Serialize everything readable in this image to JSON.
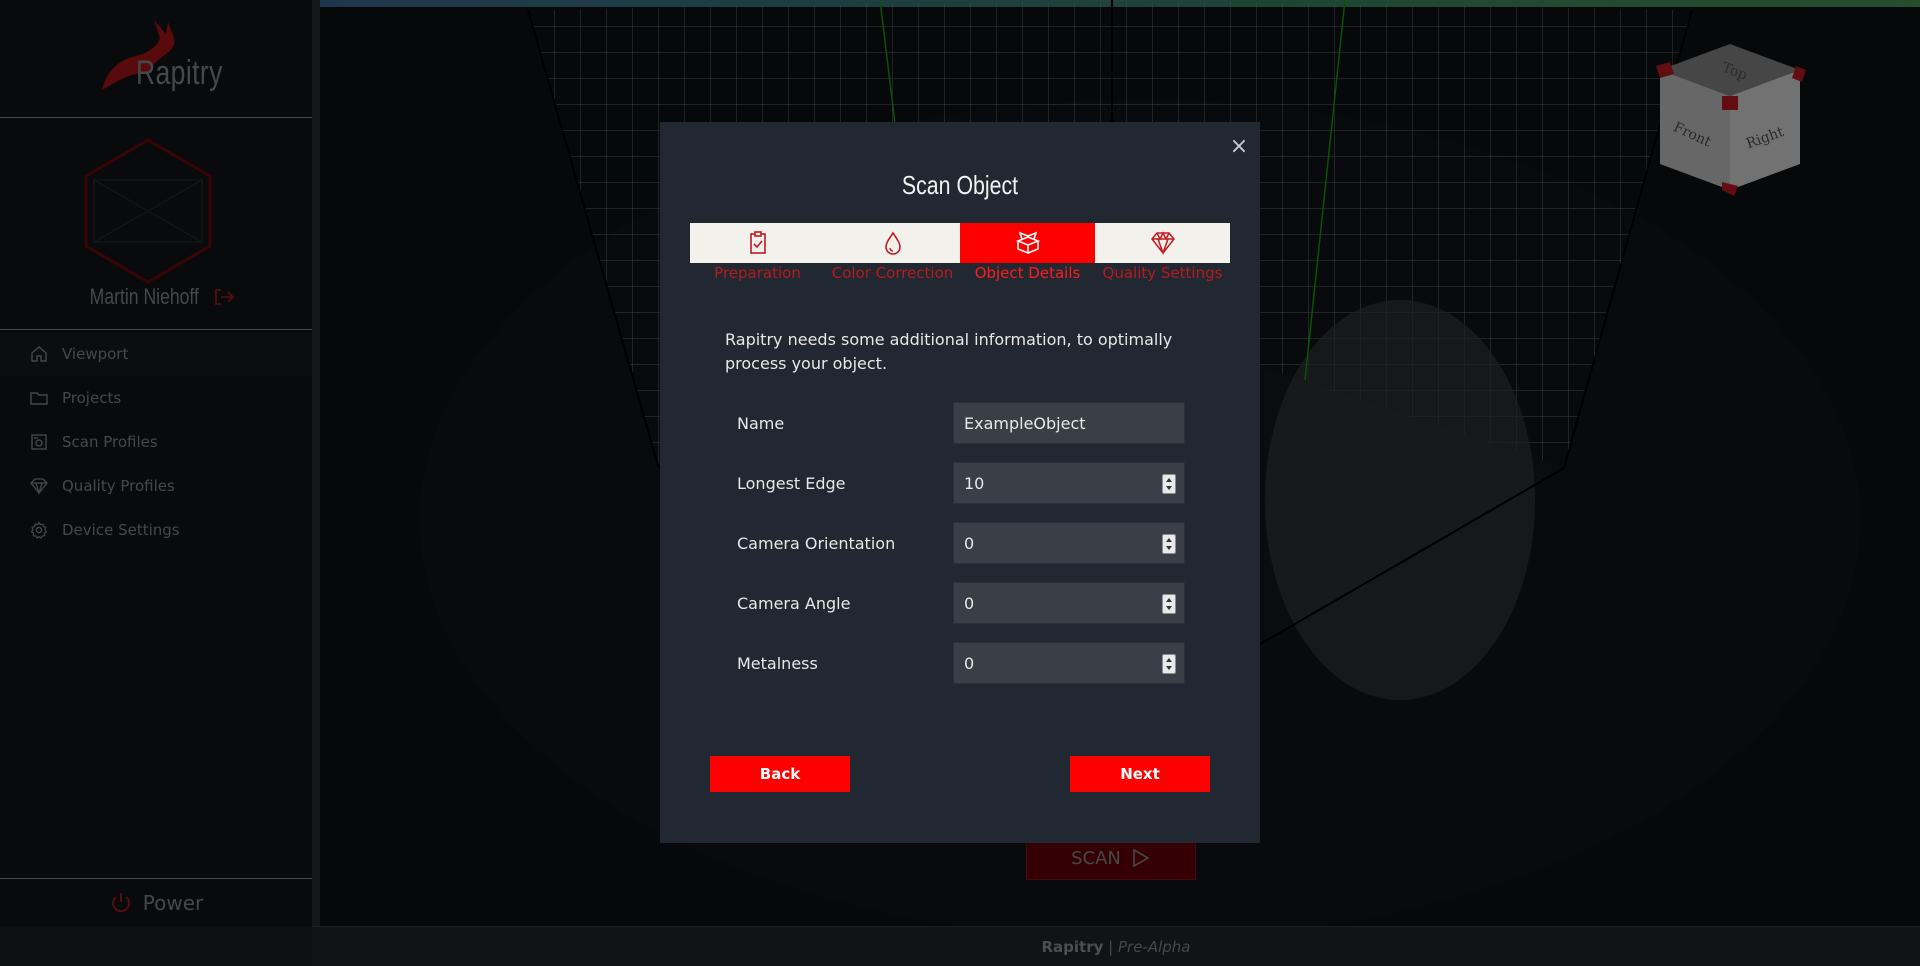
{
  "app": {
    "name": "Rapitry"
  },
  "user": {
    "name": "Martin Niehoff"
  },
  "sidebar": {
    "items": [
      {
        "label": "Viewport",
        "icon": "home-icon",
        "stripe": "#3a6d9a"
      },
      {
        "label": "Projects",
        "icon": "folder-icon",
        "stripe": "#2f8c86"
      },
      {
        "label": "Scan Profiles",
        "icon": "camera-icon",
        "stripe": "#3f9a4e"
      },
      {
        "label": "Quality Profiles",
        "icon": "diamond-icon",
        "stripe": "#8a9a2a"
      },
      {
        "label": "Device Settings",
        "icon": "gear-icon",
        "stripe": "#a02a2a"
      }
    ],
    "power_label": "Power"
  },
  "viewport": {
    "scan_label": "SCAN"
  },
  "footer": {
    "brand": "Rapitry",
    "separator": " | ",
    "stage": "Pre-Alpha"
  },
  "modal": {
    "title": "Scan Object",
    "close_glyph": "×",
    "steps": [
      {
        "label": "Preparation",
        "icon": "clipboard-check-icon",
        "active": false
      },
      {
        "label": "Color Correction",
        "icon": "droplet-icon",
        "active": false
      },
      {
        "label": "Object Details",
        "icon": "boxes-icon",
        "active": true
      },
      {
        "label": "Quality Settings",
        "icon": "diamond-icon",
        "active": false
      }
    ],
    "intro": "Rapitry needs some additional information, to optimally process your object.",
    "fields": [
      {
        "label": "Name",
        "value": "ExampleObject",
        "type": "text"
      },
      {
        "label": "Longest Edge",
        "value": "10",
        "type": "number"
      },
      {
        "label": "Camera Orientation",
        "value": "0",
        "type": "number"
      },
      {
        "label": "Camera Angle",
        "value": "0",
        "type": "number"
      },
      {
        "label": "Metalness",
        "value": "0",
        "type": "number"
      }
    ],
    "back_label": "Back",
    "next_label": "Next"
  },
  "colors": {
    "accent": "#ff0000",
    "sidebar_bg": "#111418",
    "modal_bg": "#222831"
  },
  "view_cube": {
    "faces": [
      "Top",
      "Front",
      "Right"
    ]
  }
}
